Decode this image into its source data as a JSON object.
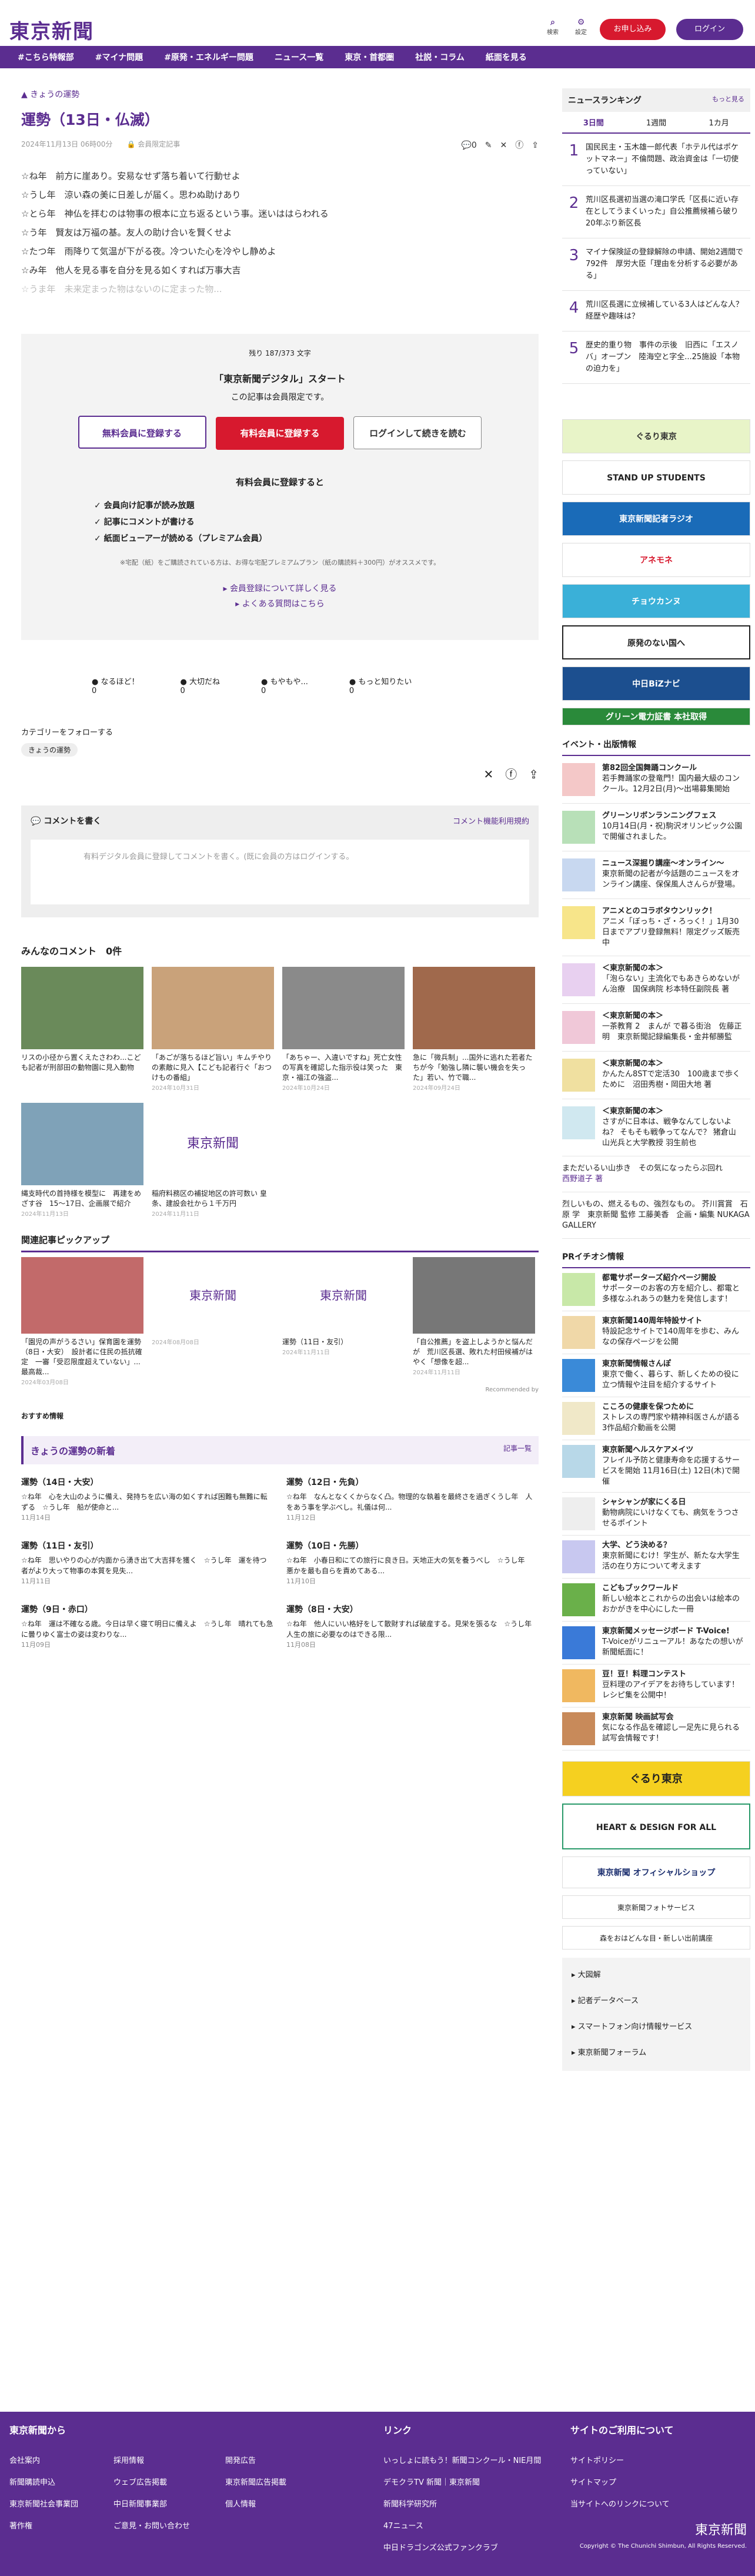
{
  "header": {
    "logo": "東京新聞",
    "search": "検索",
    "settings": "設定",
    "signup": "お申し込み",
    "login": "ログイン"
  },
  "nav": [
    "#こちら特報部",
    "#マイナ問題",
    "#原発・エネルギー問題",
    "ニュース一覧",
    "東京・首都圏",
    "社説・コラム",
    "紙面を見る"
  ],
  "article": {
    "breadcrumb": "きょうの運勢",
    "title": "運勢（13日・仏滅）",
    "date": "2024年11月13日 06時00分",
    "limited": "会員限定記事",
    "comments": "0",
    "lines": [
      "☆ね年　前方に崖あり。安易なせず落ち着いて行動せよ",
      "☆うし年　涼い森の美に日差しが届く。思わぬ助けあり",
      "☆とら年　神仏を拝むのは物事の根本に立ち返るという事。迷いははらわれる",
      "☆う年　賢友は万福の基。友人の助け合いを賢くせよ",
      "☆たつ年　雨降りて気温が下がる夜。冷ついた心を冷やし静めよ",
      "☆み年　他人を見る事を自分を見る如くすれば万事大吉",
      "☆うま年　未来定まった物はないのに定まった物..."
    ]
  },
  "gate": {
    "remaining": "残り 187/373 文字",
    "service": "「東京新聞デジタル」スタート",
    "only": "この記事は会員限定です。",
    "free": "無料会員に登録する",
    "paid": "有料会員に登録する",
    "cont": "ログインして続きを読む",
    "benefit": "有料会員に登録すると",
    "b1": "会員向け記事が読み放題",
    "b2": "記事にコメントが書ける",
    "b3": "紙面ビューアーが読める（プレミアム会員）",
    "note": "※宅配（紙）をご購読されている方は、お得な宅配プレミアムプラン（紙の購読料＋300円）がオススメです。",
    "l1": "会員登録について詳しく見る",
    "l2": "よくある質問はこちら"
  },
  "reacts": [
    {
      "l": "なるほど！",
      "c": "0"
    },
    {
      "l": "大切だね",
      "c": "0"
    },
    {
      "l": "もやもや...",
      "c": "0"
    },
    {
      "l": "もっと知りたい",
      "c": "0"
    }
  ],
  "follow": {
    "title": "カテゴリーをフォローする",
    "tag": "きょうの運勢"
  },
  "comment": {
    "title": "コメントを書く",
    "usage": "コメント機能利用規約",
    "placeholder": "有料デジタル会員に登録してコメントを書く。(既に会員の方はログインする。"
  },
  "everyone": {
    "title": "みんなのコメント　0件"
  },
  "cards": [
    {
      "t": "リスの小径から置くえたさわわ...こども記者が刑部田の動物園に見入動物",
      "d": ""
    },
    {
      "t": "「あごが落ちるほど旨い」キムチやりの素敵に見入【こども記者行ぐ「おつけもの番組」",
      "d": "2024年10月31日"
    },
    {
      "t": "「あちゃー、入違いですね」死亡女性の写真を確認した指示役は笑った　東京・福江の強盗...",
      "d": "2024年10月24日"
    },
    {
      "t": "急に「微兵制」...国外に逃れた若者たちが今「勉強し隣に襲い機会を失った」若い、竹で職...",
      "d": "2024年09月24日"
    },
    {
      "t": "縄支時代の首持様を模型に　再建をめざす谷　15～17日、企画展で紹介",
      "d": "2024年11月13日"
    },
    {
      "t": "稲府料務区の補捉地区の許可数い 皇条、建設会社から１千万円",
      "d": "2024年11月11日"
    }
  ],
  "related": {
    "title": "関連記事ピックアップ",
    "items": [
      {
        "t": "「園児の声がうるさい」保育園を運勢（8日・大安）　設計者に住民の抵抗確定　一審「受忍限度超えていない」...最高裁...",
        "d": "2024年03月08日"
      },
      {
        "t": "",
        "d": "2024年08月08日"
      },
      {
        "t": "運勢（11日・友引）",
        "d": "2024年11月11日"
      },
      {
        "t": "「自公推薦」を盗上しようかと悩んだが　荒川区長選、敗れた村田候補がはやく「想像を超...",
        "d": "2024年11月11日"
      }
    ],
    "rec": "Recommended by"
  },
  "osusume": "おすすめ情報",
  "today": {
    "title": "きょうの運勢の新着",
    "all": "記事一覧",
    "items": [
      {
        "t": "運勢（14日・大安）",
        "x": "☆ね年　心を大山のように備え、発持ちを広い海の如くすれば困難も無難に転ずる　☆うし年　船が使命と...",
        "d": "11月14日"
      },
      {
        "t": "運勢（12日・先負）",
        "x": "☆ね年　なんとなくくからなく凸。物理的な執着を最終さを過ぎくうし年　人をあう事を学ぶべし。礼儀は何...",
        "d": "11月12日"
      },
      {
        "t": "運勢（11日・友引）",
        "x": "☆ね年　思いやりの心が内面から湧き出て大吉拝を獲く　☆うし年　運を待つ者がより大って物事の本質を見失...",
        "d": "11月11日"
      },
      {
        "t": "運勢（10日・先勝）",
        "x": "☆ね年　小春日和にての旅行に良き日。天地正大の気を養うべし　☆うし年　悪かを最も自らを責めてある...",
        "d": "11月10日"
      },
      {
        "t": "運勢（9日・赤口）",
        "x": "☆ね年　運は不確なる歳。今日は早く寝て明日に備えよ　☆うし年　晴れても急に曇りゆく富士の姿は変わりな...",
        "d": "11月09日"
      },
      {
        "t": "運勢（8日・大安）",
        "x": "☆ね年　他人にいい格好をして散財すれば破産する。見栄を張るな　☆うし年　人生の旅に必要なのはできる限...",
        "d": "11月08日"
      }
    ]
  },
  "ranking": {
    "title": "ニュースランキング",
    "more": "もっと見る",
    "tabs": [
      "3日間",
      "1週間",
      "1カ月"
    ],
    "items": [
      {
        "n": "1",
        "t": "国民民主・玉木雄一郎代表「ホテル代はポケットマネー」不倫問題、政治資金は「一切使っていない」"
      },
      {
        "n": "2",
        "t": "荒川区長選初当選の滝口学氏「区長に近い存在としてうまくいった」自公推薦候補ら破り20年ぶり新区長"
      },
      {
        "n": "3",
        "t": "マイナ保険証の登録解除の申請、開始2週間で792件　厚労大臣「理由を分析する必要がある」"
      },
      {
        "n": "4",
        "t": "荒川区長選に立候補している3人はどんな人？経歴や趣味は？"
      },
      {
        "n": "5",
        "t": "歴史的重り物　事件の示後　旧西に「エスノバ」オープン　陸海空と字全...25施設「本物の迫力を」"
      }
    ]
  },
  "banners": [
    "ぐるり東京",
    "STAND UP STUDENTS",
    "東京新聞記者ラジオ",
    "アネモネ",
    "チョウカンヌ",
    "原発のない国へ",
    "中日BiZナビ",
    "グリーン電力証書 本社取得"
  ],
  "events": {
    "title": "イベント・出版情報",
    "items": [
      {
        "t": "第82回全国舞踊コンクール",
        "x": "若手舞踊家の登竜門！国内最大級のコンクール。12月2日(月)～出場募集開始"
      },
      {
        "t": "グリーンリボンランニングフェス",
        "x": "10月14日(月・祝)駒沢オリンピック公園で開催されました。"
      },
      {
        "t": "ニュース深掘り講座～オンライン～",
        "x": "東京新聞の記者が今話題のニュースをオンライン講座、保保風人さんらが登場。"
      },
      {
        "t": "アニメとのコラボタウンリック！",
        "x": "アニメ「ぼっち・ざ・ろっく！」1月30日までアプリ登録無料！限定グッズ販売中"
      },
      {
        "t": "＜東京新聞の本＞",
        "x": "「泡らない」主流化でもあきらめないがん治療　国保病院 杉本特任副院長 著"
      },
      {
        "t": "＜東京新聞の本＞",
        "x": "一茶教育 2　まんが で暮る街治　佐藤正明　東京新聞記録編集長・金井郁勝監"
      },
      {
        "t": "＜東京新聞の本＞",
        "x": "かんたん8STで定活30　100歳まで歩くために　沼田秀樹・岡田大地 著"
      },
      {
        "t": "＜東京新聞の本＞",
        "x": "さすがに日本は、戦争なんてしないよね？ そもそも戦争ってなんで？ 猪倉山山光兵と大学教授 羽生前也"
      },
      {
        "t": "まただいるい山歩き　その気になったらぶ回れ",
        "x": "西野道子 著"
      },
      {
        "t": "烈しいもの、燃えるもの、強烈なもの。 芥川賞賞　石原 学　東京新聞 監修 工藤美香　企画・編集 NUKAGA GALLERY",
        "x": ""
      }
    ]
  },
  "pr": {
    "title": "PRイチオシ情報",
    "items": [
      {
        "t": "都電サポーターズ紹介ページ開設",
        "x": "サポーターのお客の方を紹介し、都電と多様なふれあうの魅力を発信します！"
      },
      {
        "t": "東京新聞140周年特設サイト",
        "x": "特設記念サイトで140周年を歩む、みんなの保存ページを公開"
      },
      {
        "t": "東京新聞情報さんぽ",
        "x": "東京で働く、暮らす、新しくための役に立つ情報や注目を紹介するサイト"
      },
      {
        "t": "こころの健康を保つために",
        "x": "ストレスの専門家や精神科医さんが語る3作品紹介動画を公開"
      },
      {
        "t": "東京新聞ヘルスケアメイツ",
        "x": "フレイル予防と健康寿命を応援するサービスを開始 11月16日(土) 12日(木)で開催"
      },
      {
        "t": "シャシャンが家にくる日",
        "x": "動物病院にいけなくても、病気をうつさせるポイント"
      },
      {
        "t": "大学、どう決める？",
        "x": "東京新聞にむけ！学生が、新たな大学生活の在り方について考えます"
      },
      {
        "t": "こどもブックワールド",
        "x": "新しい絵本とこれからの出会いは絵本のおかがきを中心にした一冊"
      },
      {
        "t": "東京新聞メッセージボード T-Voice!",
        "x": "T-Voiceがリニューアル！あなたの想いが新聞紙面に！"
      },
      {
        "t": "豆！豆！料理コンテスト",
        "x": "豆料理のアイデアをお待ちしています！レシピ集を公開中！"
      },
      {
        "t": "東京新聞 映画試写会",
        "x": "気になる作品を確認し一足先に見られる試写会情報です！"
      }
    ]
  },
  "side_banners": [
    "ぐるり東京",
    "HEART & DESIGN FOR ALL",
    "東京新聞 オフィシャルショップ",
    "東京新聞フォトサービス",
    "森をおはどんな目・新しい出前講座"
  ],
  "side_links": [
    "大図解",
    "記者データベース",
    "スマートフォン向け情報サービス",
    "東京新聞フォーラム"
  ],
  "footer": {
    "t1": "東京新聞から",
    "c1": [
      "会社案内",
      "新聞購読申込",
      "東京新聞社会事業団",
      "著作権",
      "採用情報",
      "ウェブ広告掲載",
      "中日新聞事業部",
      "ご意見・お問い合わせ",
      "開発広告",
      "東京新聞広告掲載",
      "個人情報"
    ],
    "t2": "リンク",
    "c2": [
      "いっしょに読もう！新聞コンクール・NIE月間",
      "デモクラTV 新聞｜東京新聞",
      "新聞科学研究所",
      "47ニュース",
      "中日ドラゴンズ公式ファンクラブ"
    ],
    "t3": "サイトのご利用について",
    "c3": [
      "サイトポリシー",
      "サイトマップ",
      "当サイトへのリンクについて"
    ],
    "copy": "Copyright © The Chunichi Shimbun, All Rights Reserved."
  }
}
